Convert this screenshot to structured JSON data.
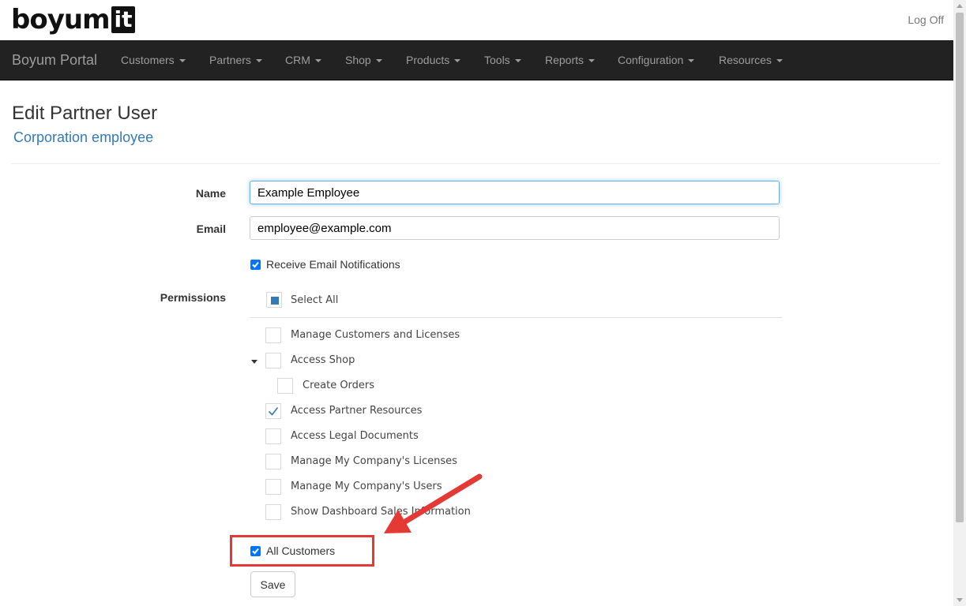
{
  "header": {
    "logo_text": "boyum",
    "logo_box_text": "it",
    "logoff_label": "Log Off"
  },
  "navbar": {
    "brand": "Boyum Portal",
    "items": [
      {
        "label": "Customers"
      },
      {
        "label": "Partners"
      },
      {
        "label": "CRM"
      },
      {
        "label": "Shop"
      },
      {
        "label": "Products"
      },
      {
        "label": "Tools"
      },
      {
        "label": "Reports"
      },
      {
        "label": "Configuration"
      },
      {
        "label": "Resources"
      }
    ]
  },
  "page": {
    "title": "Edit Partner User",
    "subtitle": "Corporation employee"
  },
  "form": {
    "name_label": "Name",
    "name_value": "Example Employee",
    "email_label": "Email",
    "email_value": "employee@example.com",
    "notifications_label": "Receive Email Notifications",
    "notifications_checked": true,
    "permissions_label": "Permissions",
    "select_all_label": "Select All",
    "permissions": [
      {
        "label": "Manage Customers and Licenses",
        "checked": false
      },
      {
        "label": "Access Shop",
        "checked": false,
        "expanded": true
      },
      {
        "label": "Create Orders",
        "checked": false,
        "child": true
      },
      {
        "label": "Access Partner Resources",
        "checked": true
      },
      {
        "label": "Access Legal Documents",
        "checked": false
      },
      {
        "label": "Manage My Company's Licenses",
        "checked": false
      },
      {
        "label": "Manage My Company's Users",
        "checked": false
      },
      {
        "label": "Show Dashboard Sales Information",
        "checked": false
      }
    ],
    "all_customers_label": "All Customers",
    "all_customers_checked": true,
    "save_label": "Save"
  },
  "colors": {
    "navbar_bg": "#222222",
    "link_blue": "#337ab7",
    "checkbox_blue": "#0075ff",
    "annotation_red": "#e53935"
  }
}
